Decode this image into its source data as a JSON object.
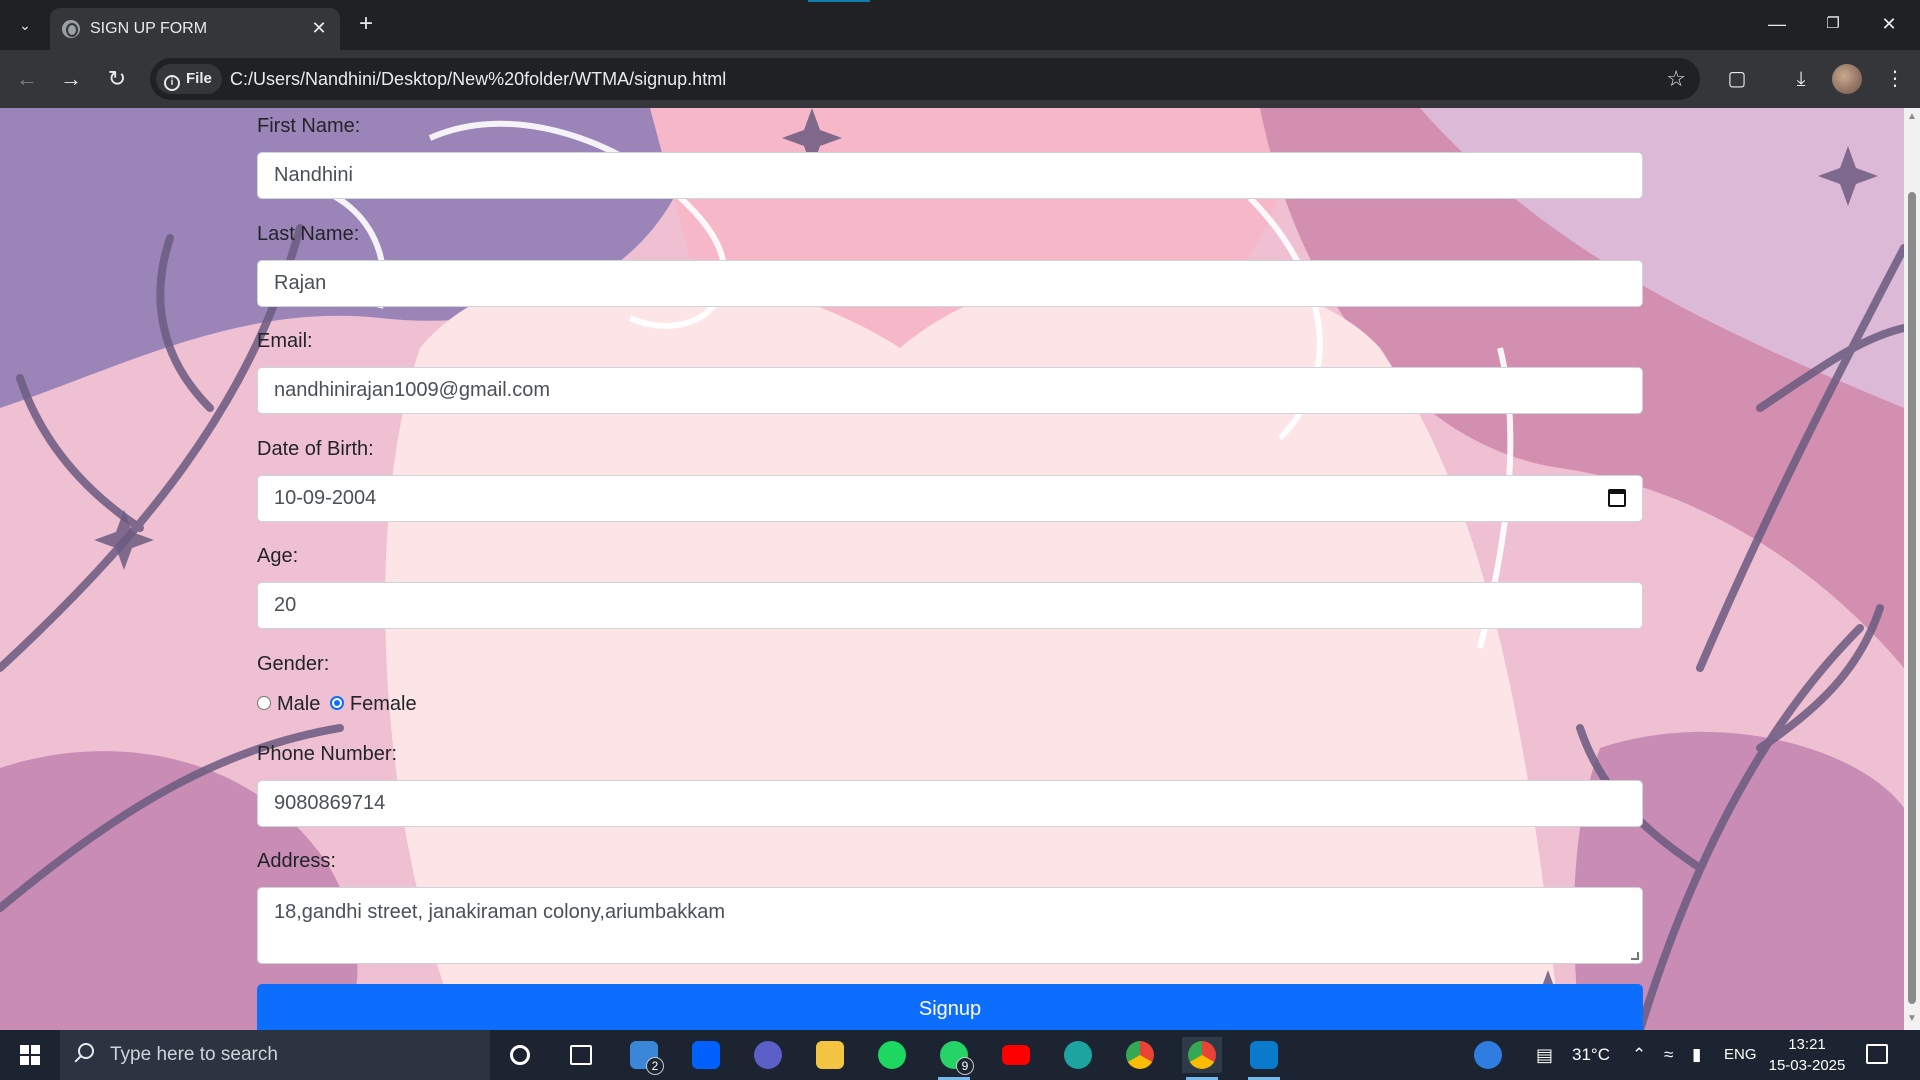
{
  "browser": {
    "tab_title": "SIGN UP FORM",
    "site_info_label": "File",
    "url": "C:/Users/Nandhini/Desktop/New%20folder/WTMA/signup.html"
  },
  "form": {
    "first_name_label": "First Name:",
    "first_name_value": "Nandhini",
    "last_name_label": "Last Name:",
    "last_name_value": "Rajan",
    "email_label": "Email:",
    "email_value": "nandhinirajan1009@gmail.com",
    "dob_label": "Date of Birth:",
    "dob_value": "10-09-2004",
    "age_label": "Age:",
    "age_value": "20",
    "gender_label": "Gender:",
    "gender_options": [
      "Male",
      "Female"
    ],
    "gender_selected": "Female",
    "phone_label": "Phone Number:",
    "phone_value": "9080869714",
    "address_label": "Address:",
    "address_value": "18,gandhi street, janakiraman colony,ariumbakkam",
    "submit_label": "Signup"
  },
  "taskbar": {
    "search_placeholder": "Type here to search",
    "mail_badge": "2",
    "whatsapp_badge": "9",
    "temperature": "31°C",
    "language": "ENG",
    "time": "13:21",
    "date": "15-03-2025"
  },
  "colors": {
    "accent": "#0d6efd",
    "page_bg": "#f1c1d3",
    "taskbar_bg": "#1b2430"
  }
}
